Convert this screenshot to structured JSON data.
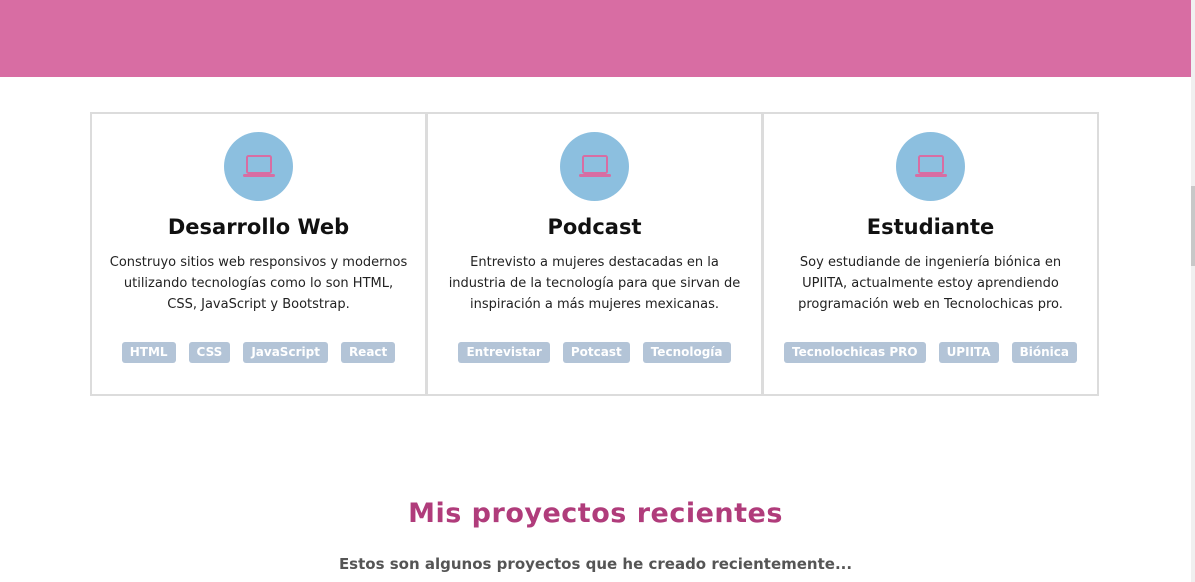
{
  "colors": {
    "header_band": "#d86da3",
    "icon_circle": "#8cbfdf",
    "icon_stroke": "#d86da3",
    "tag_bg": "#b3c4d7",
    "section_title": "#b03c7b"
  },
  "cards": [
    {
      "icon": "laptop-icon",
      "title": "Desarrollo Web",
      "description": "Construyo sitios web responsivos y modernos utilizando tecnologías como lo son HTML, CSS, JavaScript y Bootstrap.",
      "tags": [
        "HTML",
        "CSS",
        "JavaScript",
        "React"
      ]
    },
    {
      "icon": "laptop-icon",
      "title": "Podcast",
      "description": "Entrevisto a mujeres destacadas en la industria de la tecnología para que sirvan de inspiración a más mujeres mexicanas.",
      "tags": [
        "Entrevistar",
        "Potcast",
        "Tecnología"
      ]
    },
    {
      "icon": "laptop-icon",
      "title": "Estudiante",
      "description": "Soy estudiande de ingeniería biónica en UPIITA, actualmente estoy aprendiendo programación web en Tecnolochicas pro.",
      "tags": [
        "Tecnolochicas PRO",
        "UPIITA",
        "Biónica"
      ]
    }
  ],
  "projects": {
    "title": "Mis proyectos recientes",
    "subtitle": "Estos son algunos proyectos que he creado recientemente..."
  }
}
